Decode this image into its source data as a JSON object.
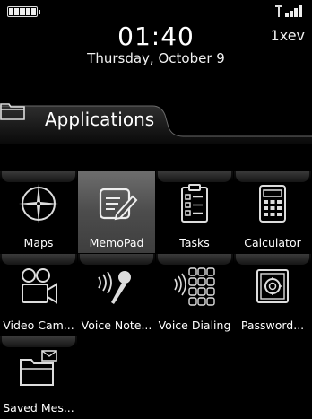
{
  "status": {
    "battery_icon": "battery-icon",
    "signal_icon": "signal-strength-icon",
    "network": "1xev",
    "time": "01:40",
    "date": "Thursday, October 9"
  },
  "folder": {
    "icon": "folder-icon",
    "title": "Applications"
  },
  "apps": [
    {
      "label": "Maps",
      "icon": "compass-icon",
      "selected": false
    },
    {
      "label": "MemoPad",
      "icon": "memopad-icon",
      "selected": true
    },
    {
      "label": "Tasks",
      "icon": "clipboard-icon",
      "selected": false
    },
    {
      "label": "Calculator",
      "icon": "calculator-icon",
      "selected": false
    },
    {
      "label": "Video Cam...",
      "icon": "video-camera-icon",
      "selected": false
    },
    {
      "label": "Voice Note...",
      "icon": "microphone-icon",
      "selected": false
    },
    {
      "label": "Voice Dialing",
      "icon": "voice-dialing-icon",
      "selected": false
    },
    {
      "label": "Password...",
      "icon": "safe-icon",
      "selected": false
    },
    {
      "label": "Saved Mes...",
      "icon": "saved-messages-icon",
      "selected": false
    }
  ],
  "colors": {
    "background": "#000000",
    "selected_tile": "#555555",
    "text": "#ffffff"
  }
}
